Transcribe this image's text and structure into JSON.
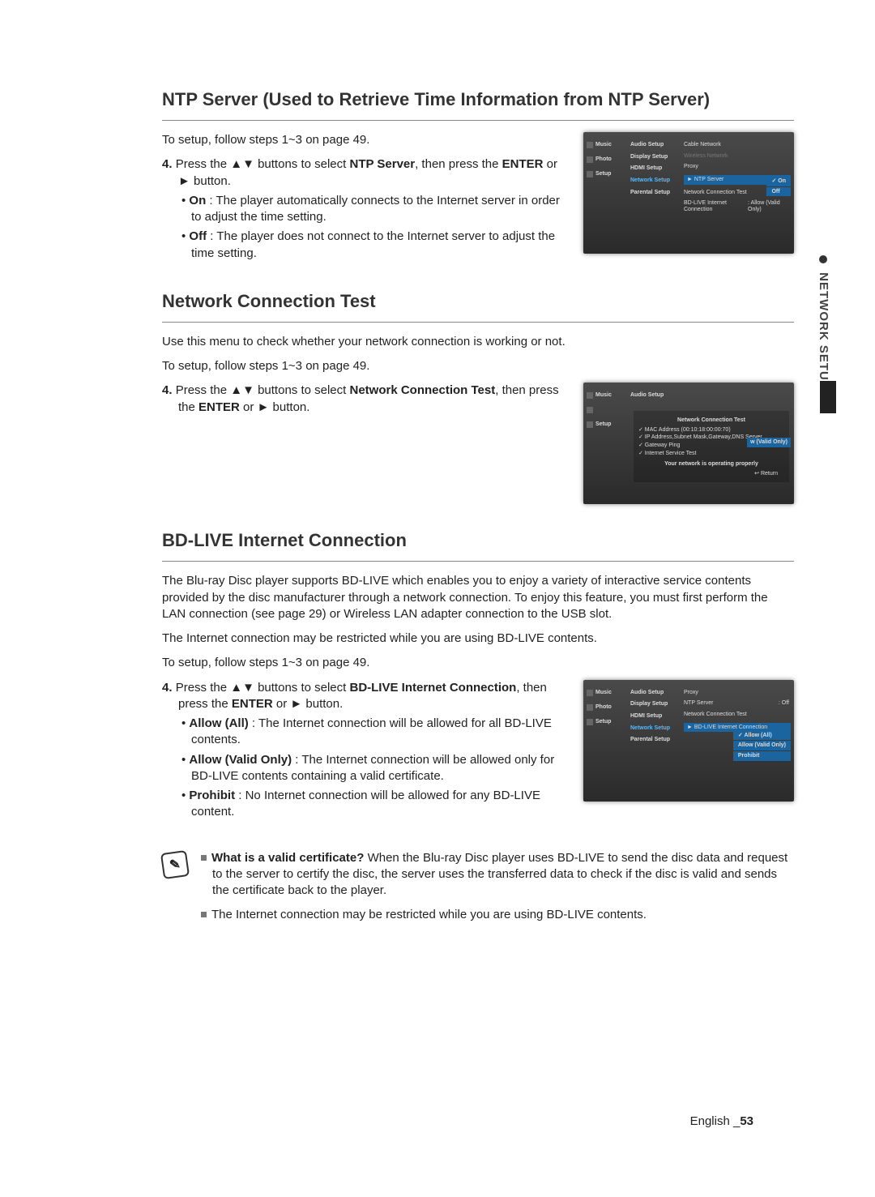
{
  "sideTab": "NETWORK SETUP",
  "pageLang": "English",
  "pageNum": "53",
  "sec1": {
    "title": "NTP Server (Used to Retrieve Time Information from NTP Server)",
    "intro": "To setup, follow steps 1~3 on page 49.",
    "step4_pre": "Press the ▲▼ buttons to select ",
    "step4_bold": "NTP Server",
    "step4_post": ", then press the ",
    "step4_bold2": "ENTER",
    "step4_post2": " or ► button.",
    "b1_bold": "On",
    "b1_rest": " : The player automatically connects to the Internet server in order to adjust the time setting.",
    "b2_bold": "Off",
    "b2_rest": " : The player does not connect to the Internet server to adjust the time setting.",
    "ss": {
      "labels": [
        "Music",
        "Photo",
        "Setup"
      ],
      "menu": [
        "Audio Setup",
        "Display Setup",
        "HDMI Setup",
        "Network Setup",
        "Parental Setup"
      ],
      "menuSel": "Network Setup",
      "sub": [
        {
          "l": "Cable Network"
        },
        {
          "l": "Wireless Network",
          "dim": true
        },
        {
          "l": "Proxy"
        },
        {
          "l": "NTP Server",
          "r": "On",
          "hl": true
        },
        {
          "l": "Network Connection Test",
          "r": "Off"
        },
        {
          "l": "BD-LIVE Internet Connection",
          "r": "Allow (Valid Only)"
        }
      ],
      "popupTop": 54,
      "popup": [
        {
          "l": "On",
          "sel": true
        },
        {
          "l": "Off"
        }
      ]
    }
  },
  "sec2": {
    "title": "Network Connection Test",
    "p1": "Use this menu to check whether your network connection is working or not.",
    "p2": "To setup, follow steps 1~3 on page 49.",
    "step4_pre": "Press the ▲▼ buttons to select ",
    "step4_bold": "Network Connection Test",
    "step4_post": ", then press the ",
    "step4_bold2": "ENTER",
    "step4_post2": " or ► button.",
    "ss": {
      "labels": [
        "Music",
        "",
        "Setup"
      ],
      "menu": [
        "Audio Setup"
      ],
      "title": "Network Connection Test",
      "lines": [
        "✓ MAC Address (00:10:18:00:00:70)",
        "✓ IP Address,Subnet Mask,Gateway,DNS Server",
        "✓ Gateway Ping",
        "✓ Internet Service Test"
      ],
      "msg": "Your network is operating properly",
      "ret": "↩ Return",
      "side": "w (Valid Only)"
    }
  },
  "sec3": {
    "title": "BD-LIVE Internet Connection",
    "p1": "The Blu-ray Disc player supports BD-LIVE which enables you to enjoy a variety of interactive service contents provided by the disc manufacturer through a network connection. To enjoy this feature, you must first perform the LAN connection (see page 29) or Wireless LAN adapter connection to the USB slot.",
    "p2": "The Internet connection may be restricted while you are using BD-LIVE contents.",
    "p3": "To setup, follow steps 1~3 on page 49.",
    "step4_pre": "Press the ▲▼ buttons to select ",
    "step4_bold": "BD-LIVE Internet Connection",
    "step4_post": ", then press the ",
    "step4_bold2": "ENTER",
    "step4_post2": " or ► button.",
    "b1_bold": "Allow (All)",
    "b1_rest": " : The Internet connection will be allowed for all BD-LIVE contents.",
    "b2_bold": "Allow (Valid Only)",
    "b2_rest": " : The Internet connection will be allowed only for BD-LIVE contents containing a valid certificate.",
    "b3_bold": "Prohibit",
    "b3_rest": " : No Internet connection will be allowed for any BD-LIVE content.",
    "ss": {
      "labels": [
        "Music",
        "Photo",
        "Setup"
      ],
      "menu": [
        "Audio Setup",
        "Display Setup",
        "HDMI Setup",
        "Network Setup",
        "Parental Setup"
      ],
      "menuSel": "Network Setup",
      "sub": [
        {
          "l": "Proxy"
        },
        {
          "l": "NTP Server",
          "r": "Off"
        },
        {
          "l": "Network Connection Test"
        },
        {
          "l": "BD-LIVE Internet Connection",
          "hl": true
        }
      ],
      "popupTop": 62,
      "popup": [
        {
          "l": "Allow (All)",
          "sel": true
        },
        {
          "l": "Allow (Valid Only)"
        },
        {
          "l": "Prohibit"
        }
      ]
    }
  },
  "notes": {
    "n1_bold": "What is a valid certificate?",
    "n1_rest": " When the Blu-ray Disc player uses BD-LIVE to send the disc data and request to the server to certify the disc, the server uses the transferred data to check if the disc is valid and sends the certificate back to the player.",
    "n2": "The Internet connection may be restricted while you are using BD-LIVE contents."
  }
}
